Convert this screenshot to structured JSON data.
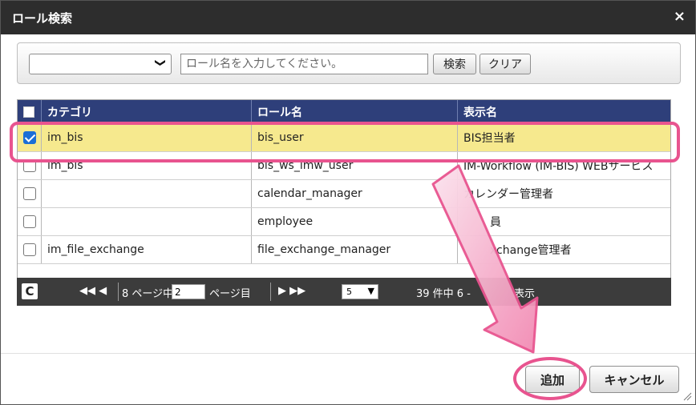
{
  "dialog": {
    "title": "ロール検索",
    "close": "×"
  },
  "search": {
    "select_value": "",
    "select_chevron": "❯",
    "placeholder": "ロール名を入力してください。",
    "search_label": "検索",
    "clear_label": "クリア"
  },
  "grid": {
    "headers": [
      "カテゴリ",
      "ロール名",
      "表示名"
    ],
    "rows": [
      {
        "checked": true,
        "category": "im_bis",
        "role": "bis_user",
        "display": "BIS担当者"
      },
      {
        "checked": false,
        "category": "im_bis",
        "role": "bis_ws_imw_user",
        "display": "IM-Workflow (IM-BIS) WEBサービス"
      },
      {
        "checked": false,
        "category": "",
        "role": "calendar_manager",
        "display": "カレンダー管理者"
      },
      {
        "checked": false,
        "category": "",
        "role": "employee",
        "display": "員"
      },
      {
        "checked": false,
        "category": "im_file_exchange",
        "role": "file_exchange_manager",
        "display": "xchange管理者"
      }
    ]
  },
  "pager": {
    "refresh": "C",
    "first_prev": "◀◀  ◀",
    "total_pages": "8 ページ中",
    "current_page": "2",
    "page_suffix": "ページ目",
    "next_last": "▶  ▶▶",
    "page_size": "5",
    "summary_prefix": "39 件中 6 -",
    "summary_suffix": "表示"
  },
  "footer": {
    "add_label": "追加",
    "cancel_label": "キャンセル"
  },
  "colors": {
    "highlight": "#e8548f",
    "header": "#2e3f7a",
    "selected_row": "#f6e98e",
    "titlebar": "#2d2d2d"
  }
}
